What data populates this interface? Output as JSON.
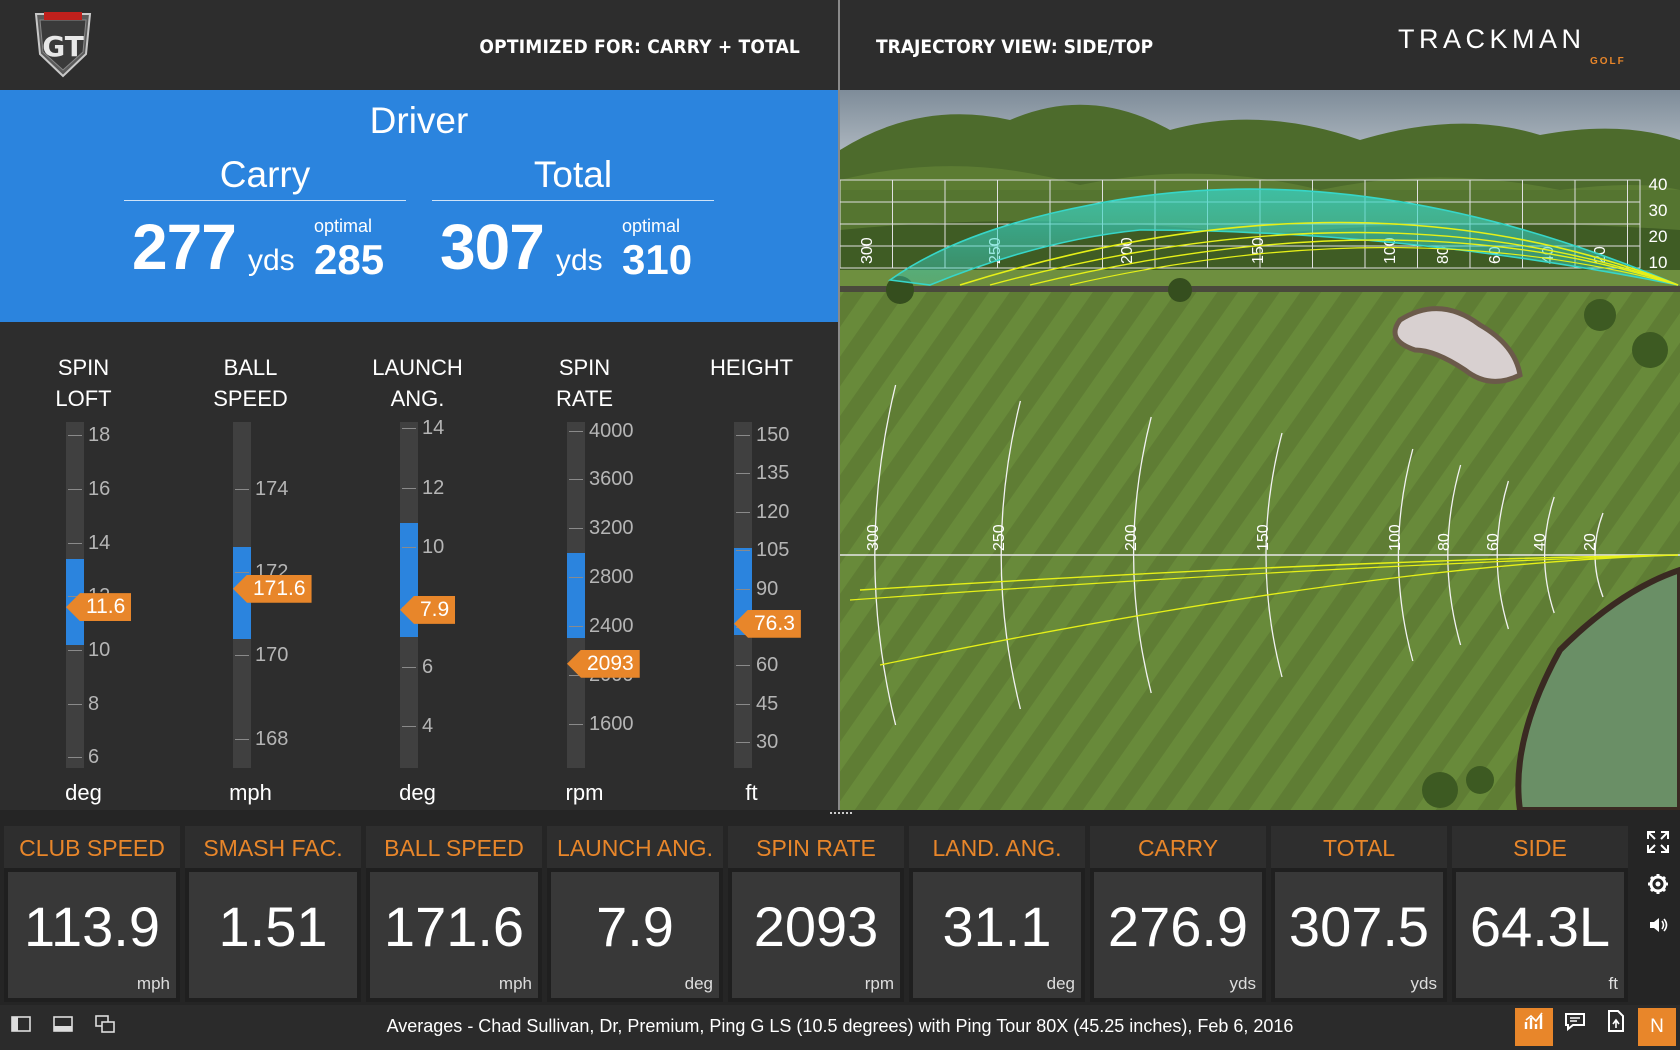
{
  "header": {
    "optimized_label": "OPTIMIZED FOR: CARRY + TOTAL",
    "trajectory_label": "TRAJECTORY VIEW: SIDE/TOP",
    "brand": "TRACKMAN",
    "brand_sub": "GOLF",
    "logo_text": "GT"
  },
  "summary": {
    "club": "Driver",
    "carry": {
      "title": "Carry",
      "value": "277",
      "unit": "yds",
      "optimal_label": "optimal",
      "optimal": "285"
    },
    "total": {
      "title": "Total",
      "value": "307",
      "unit": "yds",
      "optimal_label": "optimal",
      "optimal": "310"
    }
  },
  "gauges": [
    {
      "title": [
        "SPIN",
        "LOFT"
      ],
      "unit": "deg",
      "ticks": [
        "18",
        "16",
        "14",
        "12",
        "10",
        "8",
        "6"
      ],
      "value": "11.6",
      "min": 5.6,
      "max": 18.5,
      "zone": [
        10.2,
        13.4
      ]
    },
    {
      "title": [
        "BALL",
        "SPEED"
      ],
      "unit": "mph",
      "ticks": [
        "174",
        "172",
        "170",
        "168"
      ],
      "value": "171.6",
      "min": 167.3,
      "max": 175.6,
      "zone": [
        170.4,
        172.6
      ]
    },
    {
      "title": [
        "LAUNCH",
        "ANG."
      ],
      "unit": "deg",
      "ticks": [
        "14",
        "12",
        "10",
        "8",
        "6",
        "4"
      ],
      "value": "7.9",
      "min": 2.6,
      "max": 14.2,
      "zone": [
        7.0,
        10.8
      ]
    },
    {
      "title": [
        "SPIN",
        "RATE"
      ],
      "unit": "rpm",
      "ticks": [
        "4000",
        "3600",
        "3200",
        "2800",
        "2400",
        "2000",
        "1600"
      ],
      "value": "2093",
      "min": 1240,
      "max": 4070,
      "zone": [
        2300,
        3000
      ]
    },
    {
      "title": [
        "HEIGHT",
        ""
      ],
      "unit": "ft",
      "ticks": [
        "150",
        "135",
        "120",
        "105",
        "90",
        "75",
        "60",
        "45",
        "30"
      ],
      "value": "76.3",
      "min": 20,
      "max": 155,
      "zone": [
        72,
        106
      ]
    }
  ],
  "stats": [
    {
      "label": "CLUB SPEED",
      "value": "113.9",
      "unit": "mph"
    },
    {
      "label": "SMASH FAC.",
      "value": "1.51",
      "unit": ""
    },
    {
      "label": "BALL SPEED",
      "value": "171.6",
      "unit": "mph"
    },
    {
      "label": "LAUNCH ANG.",
      "value": "7.9",
      "unit": "deg"
    },
    {
      "label": "SPIN RATE",
      "value": "2093",
      "unit": "rpm"
    },
    {
      "label": "LAND. ANG.",
      "value": "31.1",
      "unit": "deg"
    },
    {
      "label": "CARRY",
      "value": "276.9",
      "unit": "yds"
    },
    {
      "label": "TOTAL",
      "value": "307.5",
      "unit": "yds"
    },
    {
      "label": "SIDE",
      "value": "64.3L",
      "unit": "ft"
    }
  ],
  "scene": {
    "distance_labels": [
      "300",
      "250",
      "200",
      "150",
      "100",
      "80",
      "60",
      "40",
      "20"
    ],
    "height_labels": [
      "40",
      "30",
      "20",
      "10"
    ]
  },
  "footer": {
    "text": "Averages - Chad Sullivan, Dr, Premium, Ping G LS (10.5 degrees) with Ping Tour 80X (45.25 inches), Feb 6, 2016",
    "n_button": "N"
  },
  "colors": {
    "accent": "#e8862a",
    "blue": "#2b84de",
    "trajectory": "#e6f018",
    "trajectory_highlight": "#37d6c8"
  }
}
